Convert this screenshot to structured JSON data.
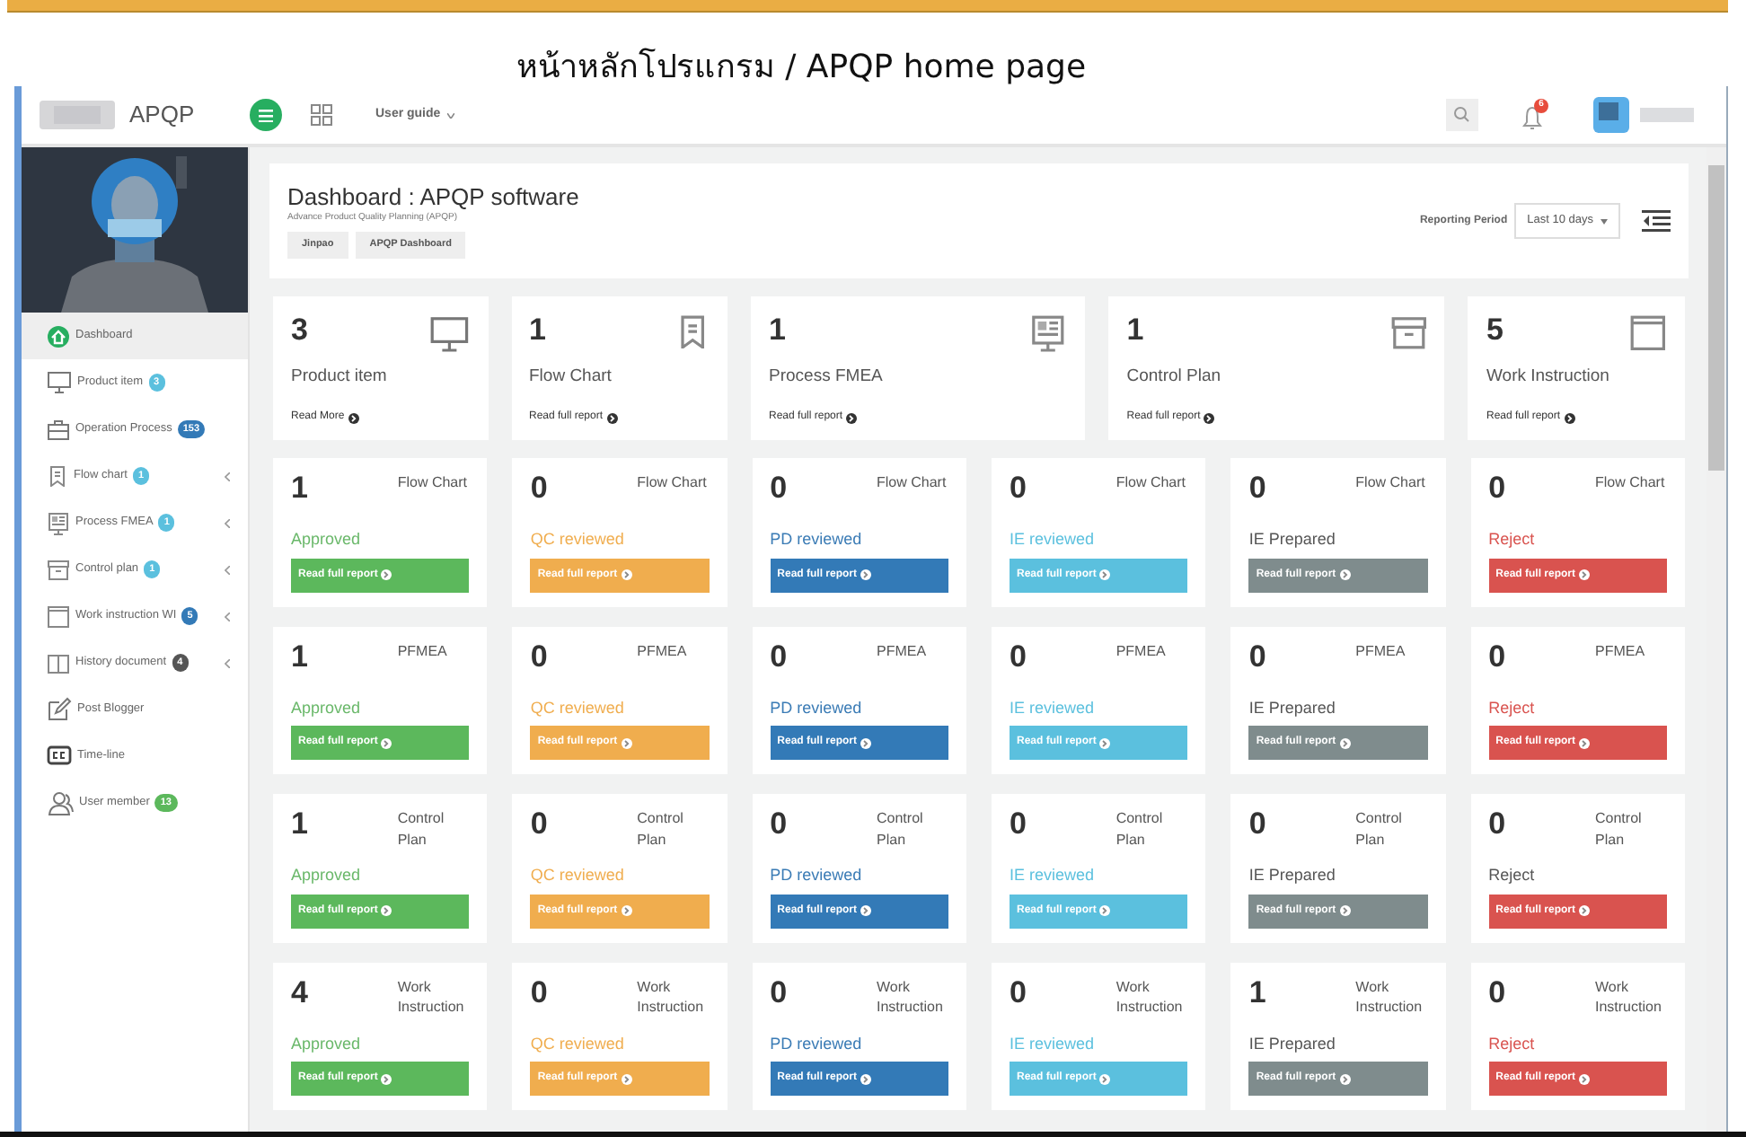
{
  "caption": "หน้าหลักโปรแกรม / APQP home page",
  "header": {
    "brand": "APQP",
    "menu_link": "User guide",
    "notifications": "6"
  },
  "sidebar": {
    "items": [
      {
        "kind": "home",
        "label": "Dashboard",
        "selected": true
      },
      {
        "kind": "monitor",
        "label": "Product item",
        "badge": "3",
        "color": "#5bc0de",
        "selected": false
      },
      {
        "kind": "briefcase",
        "label": "Operation Process",
        "badge": "153",
        "color": "#337ab7",
        "selected": false
      },
      {
        "kind": "bookmark",
        "label": "Flow chart",
        "badge": "1",
        "color": "#5bc0de",
        "submenu": true,
        "selected": false
      },
      {
        "kind": "fmea",
        "label": "Process FMEA",
        "badge": "1",
        "color": "#5bc0de",
        "submenu": true,
        "selected": false
      },
      {
        "kind": "archive",
        "label": "Control plan",
        "badge": "1",
        "color": "#5bc0de",
        "submenu": true,
        "selected": false
      },
      {
        "kind": "window",
        "label": "Work instruction WI",
        "badge": "5",
        "color": "#337ab7",
        "submenu": true,
        "selected": false
      },
      {
        "kind": "book",
        "label": "History document",
        "badge": "4",
        "color": "#555555",
        "submenu": true,
        "selected": false
      },
      {
        "kind": "edit",
        "label": "Post Blogger",
        "selected": false
      },
      {
        "kind": "cc",
        "label": "Time-line",
        "selected": false
      },
      {
        "kind": "users",
        "label": "User member",
        "badge": "13",
        "color": "#5cb85c",
        "selected": false
      }
    ]
  },
  "dashboard": {
    "title": "Dashboard : APQP software",
    "subtitle": "Advance Product Quality Planning (APQP)",
    "breadcrumb": [
      "Jinpao",
      "APQP Dashboard"
    ],
    "period_label": "Reporting Period",
    "period": "Last 10 days"
  },
  "summary": [
    {
      "kind": "monitor",
      "value": "3",
      "label": "Product item",
      "link": "Read More"
    },
    {
      "kind": "bookmark",
      "value": "1",
      "label": "Flow Chart",
      "link": "Read full report"
    },
    {
      "kind": "fmea",
      "value": "1",
      "label": "Process FMEA",
      "link": "Read full report"
    },
    {
      "kind": "archive",
      "value": "1",
      "label": "Control Plan",
      "link": "Read full report"
    },
    {
      "kind": "window",
      "value": "5",
      "label": "Work Instruction",
      "link": "Read full report"
    }
  ],
  "status_rows": [
    {
      "cards": [
        {
          "value": "1",
          "category": "Flow Chart",
          "status": "Approved",
          "color": "#6ab86a",
          "kind": "success",
          "link": "Read full report"
        },
        {
          "value": "0",
          "category": "Flow Chart",
          "status": "QC reviewed",
          "color": "#f0ad4e",
          "kind": "warning",
          "link": "Read full report"
        },
        {
          "value": "0",
          "category": "Flow Chart",
          "status": "PD reviewed",
          "color": "#3a7bb5",
          "kind": "primary",
          "link": "Read full report"
        },
        {
          "value": "0",
          "category": "Flow Chart",
          "status": "IE reviewed",
          "color": "#5bc0de",
          "kind": "info",
          "link": "Read full report"
        },
        {
          "value": "0",
          "category": "Flow Chart",
          "status": "IE Prepared",
          "color": "#555555",
          "kind": "dark",
          "link": "Read full report"
        },
        {
          "value": "0",
          "category": "Flow Chart",
          "status": "Reject",
          "color": "#d9534f",
          "kind": "danger",
          "link": "Read full report"
        }
      ]
    },
    {
      "cards": [
        {
          "value": "1",
          "category": "PFMEA",
          "status": "Approved",
          "color": "#6ab86a",
          "kind": "success",
          "link": "Read full report"
        },
        {
          "value": "0",
          "category": "PFMEA",
          "status": "QC reviewed",
          "color": "#f0ad4e",
          "kind": "warning",
          "link": "Read full report"
        },
        {
          "value": "0",
          "category": "PFMEA",
          "status": "PD reviewed",
          "color": "#3a7bb5",
          "kind": "primary",
          "link": "Read full report"
        },
        {
          "value": "0",
          "category": "PFMEA",
          "status": "IE reviewed",
          "color": "#5bc0de",
          "kind": "info",
          "link": "Read full report"
        },
        {
          "value": "0",
          "category": "PFMEA",
          "status": "IE Prepared",
          "color": "#555555",
          "kind": "dark",
          "link": "Read full report"
        },
        {
          "value": "0",
          "category": "PFMEA",
          "status": "Reject",
          "color": "#d9534f",
          "kind": "danger",
          "link": "Read full report"
        }
      ]
    },
    {
      "cards": [
        {
          "value": "1",
          "category": "Control Plan",
          "status": "Approved",
          "color": "#6ab86a",
          "kind": "success",
          "link": "Read full report"
        },
        {
          "value": "0",
          "category": "Control Plan",
          "status": "QC reviewed",
          "color": "#f0ad4e",
          "kind": "warning",
          "link": "Read full report"
        },
        {
          "value": "0",
          "category": "Control Plan",
          "status": "PD reviewed",
          "color": "#3a7bb5",
          "kind": "primary",
          "link": "Read full report"
        },
        {
          "value": "0",
          "category": "Control Plan",
          "status": "IE reviewed",
          "color": "#5bc0de",
          "kind": "info",
          "link": "Read full report"
        },
        {
          "value": "0",
          "category": "Control Plan",
          "status": "IE Prepared",
          "color": "#555555",
          "kind": "dark",
          "link": "Read full report"
        },
        {
          "value": "0",
          "category": "Control Plan",
          "status": "Reject",
          "color": "#555555",
          "kind": "danger",
          "link": "Read full report"
        }
      ]
    },
    {
      "cards": [
        {
          "value": "4",
          "category": "Work Instruction",
          "status": "Approved",
          "color": "#6ab86a",
          "kind": "success",
          "link": "Read full report"
        },
        {
          "value": "0",
          "category": "Work Instruction",
          "status": "QC reviewed",
          "color": "#f0ad4e",
          "kind": "warning",
          "link": "Read full report"
        },
        {
          "value": "0",
          "category": "Work Instruction",
          "status": "PD reviewed",
          "color": "#3a7bb5",
          "kind": "primary",
          "link": "Read full report"
        },
        {
          "value": "0",
          "category": "Work Instruction",
          "status": "IE reviewed",
          "color": "#5bc0de",
          "kind": "info",
          "link": "Read full report"
        },
        {
          "value": "1",
          "category": "Work Instruction",
          "status": "IE Prepared",
          "color": "#555555",
          "kind": "dark",
          "link": "Read full report"
        },
        {
          "value": "0",
          "category": "Work Instruction",
          "status": "Reject",
          "color": "#d9534f",
          "kind": "danger",
          "link": "Read full report"
        }
      ]
    }
  ]
}
